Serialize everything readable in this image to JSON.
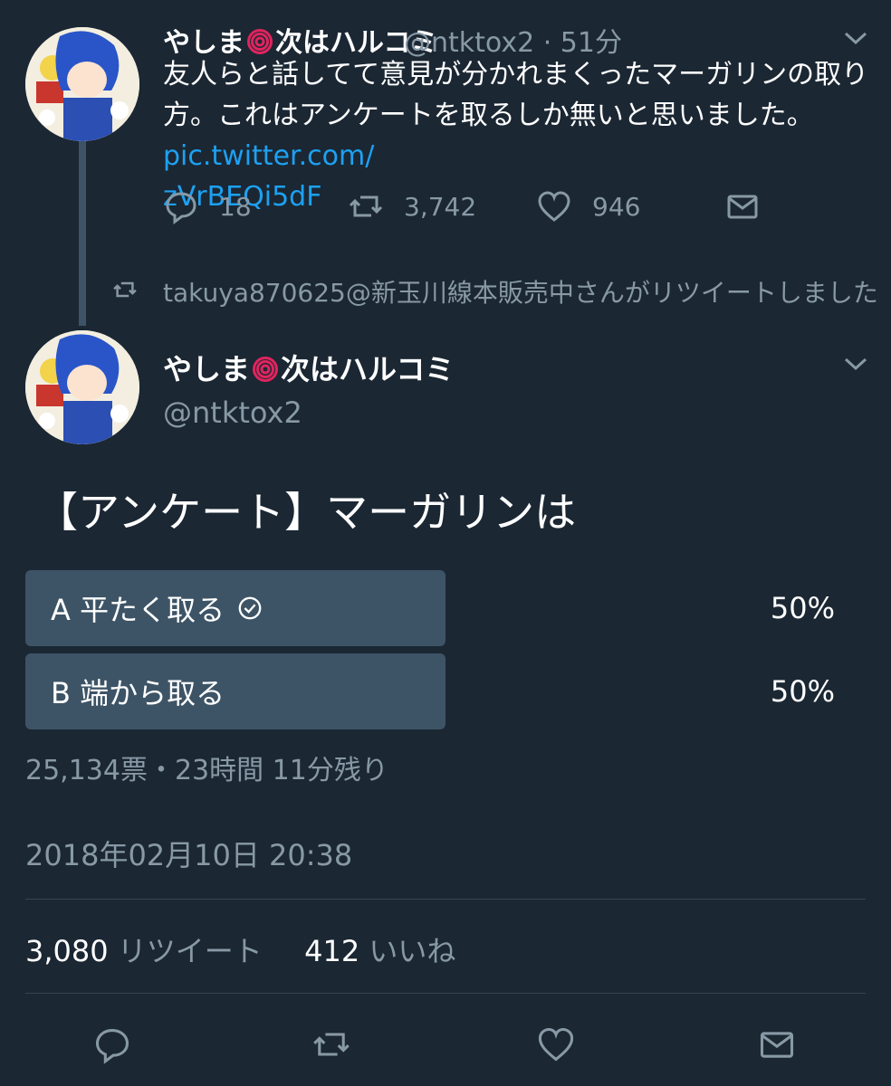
{
  "colors": {
    "background": "#1b2733",
    "text": "#ffffff",
    "muted": "#8899a6",
    "link": "#1da1f2",
    "poll_bar": "#3d5466",
    "divider": "#38444d",
    "flower": "#e0245e"
  },
  "first_tweet": {
    "name_part1": "やしま",
    "name_part2": "次はハルコミ",
    "handle_time": "@ntktox2 · 51分",
    "text": "友人らと話してて意見が分かれまくったマーガリンの取り方。これはアンケートを取るしか無いと思いました。",
    "link_line1": "pic.twitter.com/",
    "link_line2": "zVrBEQi5dF",
    "reply_count": "18",
    "retweet_count": "3,742",
    "like_count": "946",
    "icons": [
      "reply-icon",
      "retweet-icon",
      "like-icon",
      "message-icon",
      "chevron-down-icon"
    ]
  },
  "retweet_note": "takuya870625@新玉川線本販売中さんがリツイートしました",
  "main_tweet": {
    "name_part1": "やしま",
    "name_part2": "次はハルコミ",
    "handle": "@ntktox2",
    "poll_question": "【アンケート】マーガリンは",
    "poll_options": [
      {
        "label": "A 平たく取る",
        "percent": "50%",
        "percent_value": 50,
        "selected": true
      },
      {
        "label": "B 端から取る",
        "percent": "50%",
        "percent_value": 50,
        "selected": false
      }
    ],
    "poll_meta": "25,134票・23時間 11分残り",
    "timestamp": "2018年02月10日 20:38",
    "retweets_value": "3,080",
    "retweets_label": "リツイート",
    "likes_value": "412",
    "likes_label": "いいね"
  }
}
